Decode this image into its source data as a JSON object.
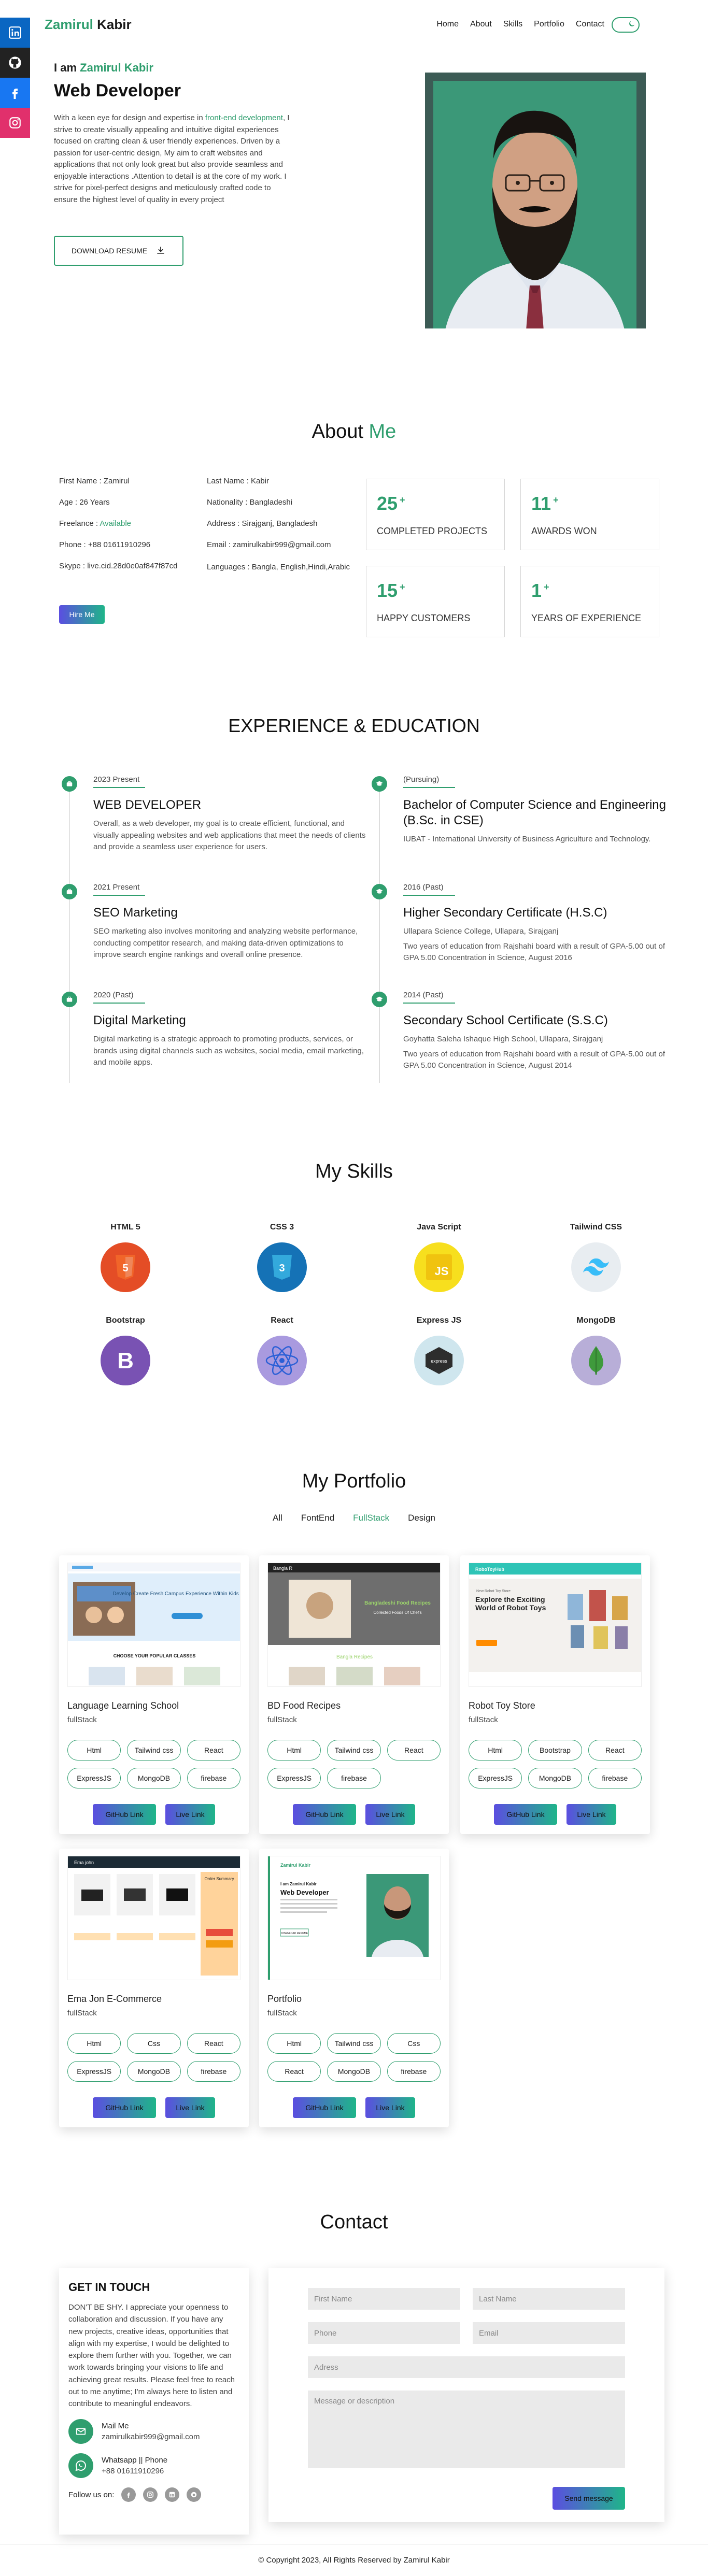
{
  "brand": {
    "first": "Zamirul",
    "last": " Kabir",
    "accent": "#2f9e6e"
  },
  "nav": {
    "items": [
      "Home",
      "About",
      "Skills",
      "Portfolio",
      "Contact"
    ]
  },
  "hero": {
    "greeting_prefix": "I am ",
    "name": "Zamirul Kabir",
    "role": "Web Developer",
    "desc_before": "With a keen eye for design and expertise in ",
    "desc_highlight": "front-end development",
    "desc_after": ", I strive to create visually appealing and intuitive digital experiences focused on crafting clean & user friendly experiences. Driven by a passion for user-centric design, My aim to craft websites and applications that not only look great but also provide seamless and enjoyable interactions .Attention to detail is at the core of my work. I strive for pixel-perfect designs and meticulously crafted code to ensure the highest level of quality in every project",
    "download_label": "DOWNLOAD RESUME"
  },
  "about": {
    "title_main": "About ",
    "title_accent": "Me",
    "info": [
      "First Name : Zamirul",
      "Last Name : Kabir",
      "Age : 26 Years",
      "Nationality : Bangladeshi",
      "Freelance : ",
      "Address : Sirajganj, Bangladesh",
      "Phone : +88 01611910296",
      "Email : zamirulkabir999@gmail.com",
      "Skype : live.cid.28d0e0af847f87cd",
      "Languages : Bangla, English,Hindi,Arabic"
    ],
    "freelance_status": "Available",
    "hire_label": "Hire Me",
    "stats": [
      {
        "num": "25",
        "plus": "+",
        "label": "COMPLETED PROJECTS"
      },
      {
        "num": "11",
        "plus": "+",
        "label": "AWARDS WON"
      },
      {
        "num": "15",
        "plus": "+",
        "label": "HAPPY CUSTOMERS"
      },
      {
        "num": "1",
        "plus": "+",
        "label": "YEARS OF EXPERIENCE"
      }
    ]
  },
  "experience": {
    "title": "EXPERIENCE & EDUCATION",
    "left": [
      {
        "date": "2023 Present",
        "title": "WEB DEVELOPER",
        "desc": "Overall, as a web developer, my goal is to create efficient, functional, and visually appealing websites and web applications that meet the needs of clients and provide a seamless user experience for users."
      },
      {
        "date": "2021 Present",
        "title": "SEO Marketing",
        "desc": "SEO marketing also involves monitoring and analyzing website performance, conducting competitor research, and making data-driven optimizations to improve search engine rankings and overall online presence."
      },
      {
        "date": "2020 (Past)",
        "title": "Digital Marketing",
        "desc": "Digital marketing is a strategic approach to promoting products, services, or brands using digital channels such as websites, social media, email marketing, and mobile apps."
      }
    ],
    "right": [
      {
        "date": "(Pursuing)",
        "title": "Bachelor of Computer Science and Engineering (B.Sc. in CSE)",
        "desc": "IUBAT - International University of Business Agriculture and Technology."
      },
      {
        "date": "2016 (Past)",
        "title": "Higher Secondary Certificate (H.S.C)",
        "desc": "Ullapara Science College, Ullapara, Sirajganj",
        "desc2": "Two years of education from Rajshahi board with a result of GPA-5.00 out of GPA 5.00 Concentration in Science, August 2016"
      },
      {
        "date": "2014 (Past)",
        "title": "Secondary School Certificate (S.S.C)",
        "desc": "Goyhatta Saleha Ishaque High School, Ullapara, Sirajganj",
        "desc2": "Two years of education from Rajshahi board with a result of GPA-5.00 out of GPA 5.00 Concentration in Science, August 2014"
      }
    ]
  },
  "skills": {
    "title": "My Skills",
    "items": [
      {
        "name": "HTML 5",
        "icon": "html5-icon",
        "color": "#e44d26"
      },
      {
        "name": "CSS 3",
        "icon": "css3-icon",
        "color": "#1572b6"
      },
      {
        "name": "Java Script",
        "icon": "javascript-icon",
        "color": "#f7df1e"
      },
      {
        "name": "Tailwind CSS",
        "icon": "tailwind-icon",
        "color": "#38bdf8"
      },
      {
        "name": "Bootstrap",
        "icon": "bootstrap-icon",
        "color": "#7952b3"
      },
      {
        "name": "React",
        "icon": "react-icon",
        "color": "#61dafb"
      },
      {
        "name": "Express JS",
        "icon": "express-icon",
        "color": "#333333"
      },
      {
        "name": "MongoDB",
        "icon": "mongodb-icon",
        "color": "#47a248"
      }
    ]
  },
  "portfolio": {
    "title": "My Portfolio",
    "filters": [
      "All",
      "FontEnd",
      "FullStack",
      "Design"
    ],
    "active_filter": "FullStack",
    "github_label": "GitHub Link",
    "live_label": "Live Link",
    "projects": [
      {
        "title": "Language Learning School",
        "category": "fullStack",
        "tags": [
          "Html",
          "Tailwind css",
          "React",
          "ExpressJS",
          "MongoDB",
          "firebase"
        ],
        "thumb": {
          "heading": "Develop Create Fresh Campus Experience Within Kids Unlike Ever",
          "section": "CHOOSE YOUR POPULAR CLASSES"
        }
      },
      {
        "title": "BD Food Recipes",
        "category": "fullStack",
        "tags": [
          "Html",
          "Tailwind css",
          "React",
          "ExpressJS",
          "firebase"
        ],
        "thumb": {
          "brand": "Bangla R",
          "heading": "Bangladeshi Food Recipes",
          "sub": "Collected Foods Of Chef's",
          "section": "Bangla Recipes"
        }
      },
      {
        "title": "Robot Toy Store",
        "category": "fullStack",
        "tags": [
          "Html",
          "Bootstrap",
          "React",
          "ExpressJS",
          "MongoDB",
          "firebase"
        ],
        "thumb": {
          "brand": "RoboToyHub",
          "small": "New Robot Toy Store",
          "heading": "Explore the Exciting World of Robot Toys"
        }
      },
      {
        "title": "Ema Jon E-Commerce",
        "category": "fullStack",
        "tags": [
          "Html",
          "Css",
          "React",
          "ExpressJS",
          "MongoDB",
          "firebase"
        ],
        "thumb": {
          "brand": "Ema john",
          "summary": "Order Summary"
        }
      },
      {
        "title": "Portfolio",
        "category": "fullStack",
        "tags": [
          "Html",
          "Tailwind css",
          "Css",
          "React",
          "MongoDB",
          "firebase"
        ],
        "thumb": {
          "brand": "Zamirul Kabir",
          "greeting": "I am Zamirul Kabir",
          "heading": "Web Developer",
          "button": "DOWNLOAD RESUME"
        }
      }
    ]
  },
  "contact": {
    "title": "Contact",
    "get_in_touch": "GET IN TOUCH",
    "text": "DON'T BE SHY. I appreciate your openness to collaboration and discussion. If you have any new projects, creative ideas, opportunities that align with my expertise, I would be delighted to explore them further with you. Together, we can work towards bringing your visions to life and achieving great results. Please feel free to reach out to me anytime; I'm always here to listen and contribute to meaningful endeavors.",
    "mail_label": "Mail Me",
    "mail_value": "zamirulkabir999@gmail.com",
    "phone_label": "Whatsapp || Phone",
    "phone_value": "+88 01611910296",
    "follow_label": "Follow us on:",
    "form": {
      "first_name": "First Name",
      "last_name": "Last Name",
      "phone": "Phone",
      "email": "Email",
      "adress": "Adress",
      "message": "Message or description",
      "send": "Send message"
    }
  },
  "footer": {
    "copyright": "© Copyright 2023, All Rights Reserved by Zamirul Kabir"
  }
}
